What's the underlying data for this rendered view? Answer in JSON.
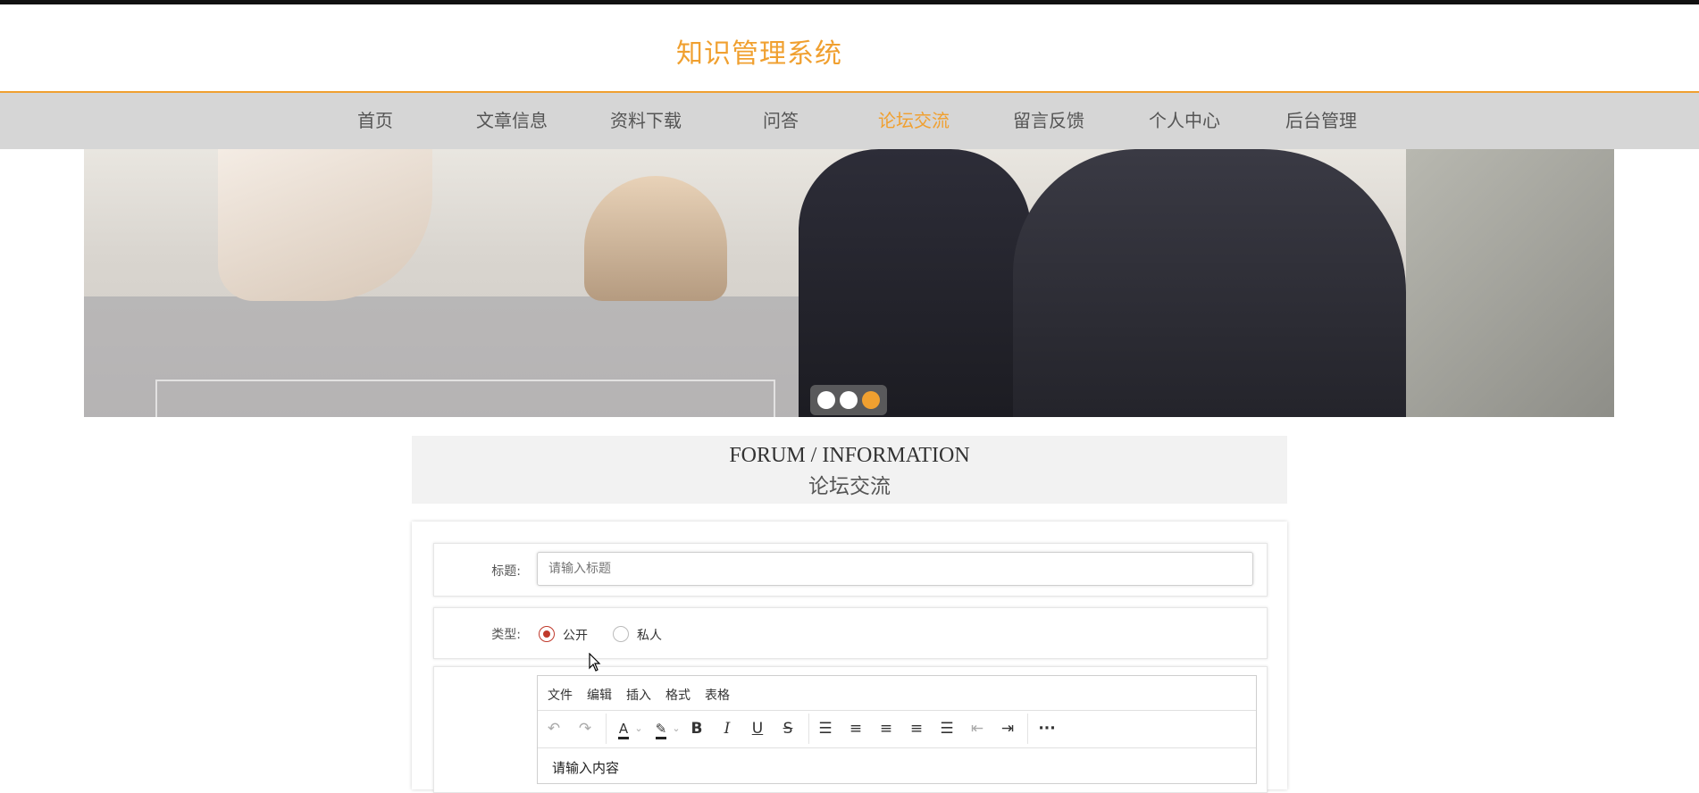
{
  "site": {
    "title": "知识管理系统"
  },
  "nav": {
    "items": [
      {
        "label": "首页"
      },
      {
        "label": "文章信息"
      },
      {
        "label": "资料下载"
      },
      {
        "label": "问答"
      },
      {
        "label": "论坛交流"
      },
      {
        "label": "留言反馈"
      },
      {
        "label": "个人中心"
      },
      {
        "label": "后台管理"
      }
    ],
    "active_index": 4
  },
  "banner": {
    "slide_count": 3,
    "active_slide": 3
  },
  "section": {
    "title_en": "FORUM / INFORMATION",
    "title_cn": "论坛交流"
  },
  "form": {
    "title_label": "标题:",
    "title_placeholder": "请输入标题",
    "type_label": "类型:",
    "type_options": [
      {
        "label": "公开",
        "checked": true
      },
      {
        "label": "私人",
        "checked": false
      }
    ],
    "editor": {
      "menus": [
        "文件",
        "编辑",
        "插入",
        "格式",
        "表格"
      ],
      "toolbar_icons": [
        "undo-icon",
        "redo-icon",
        "text-color-icon",
        "highlight-color-icon",
        "bold-icon",
        "italic-icon",
        "underline-icon",
        "strikethrough-icon",
        "line-height-icon",
        "align-left-icon",
        "align-center-icon",
        "align-right-icon",
        "align-justify-icon",
        "outdent-icon",
        "indent-icon",
        "more-icon"
      ],
      "content_placeholder": "请输入内容"
    }
  },
  "colors": {
    "accent": "#f0a030",
    "nav_bg": "#d6d6d6",
    "radio_checked": "#c0392b"
  }
}
